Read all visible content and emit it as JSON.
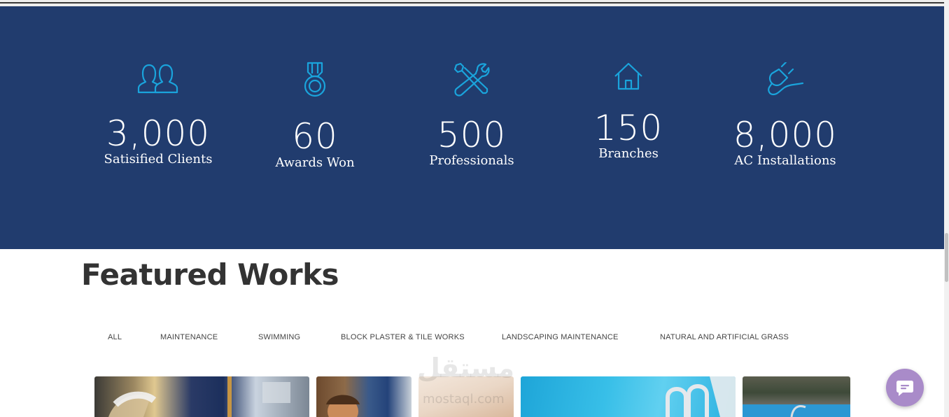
{
  "stats": [
    {
      "icon": "users-icon",
      "value": "3,000",
      "label": "Satisified Clients"
    },
    {
      "icon": "medal-icon",
      "value": "60",
      "label": "Awards Won"
    },
    {
      "icon": "tools-icon",
      "value": "500",
      "label": "Professionals"
    },
    {
      "icon": "home-icon",
      "value": "150",
      "label": "Branches"
    },
    {
      "icon": "plug-icon",
      "value": "8,000",
      "label": "AC Installations"
    }
  ],
  "featured": {
    "title": "Featured Works",
    "filters": [
      "ALL",
      "MAINTENANCE",
      "SWIMMING",
      "BLOCK PLASTER & TILE WORKS",
      "LANDSCAPING MAINTENANCE",
      "NATURAL AND ARTIFICIAL GRASS"
    ]
  },
  "watermark": {
    "text": "مستقل",
    "sub": "mostaql.com"
  },
  "chat": {
    "icon": "chat-icon"
  },
  "colors": {
    "band": "#213c6e",
    "icon": "#1aa4dc",
    "chat": "#a98bc9",
    "title": "#333333"
  }
}
